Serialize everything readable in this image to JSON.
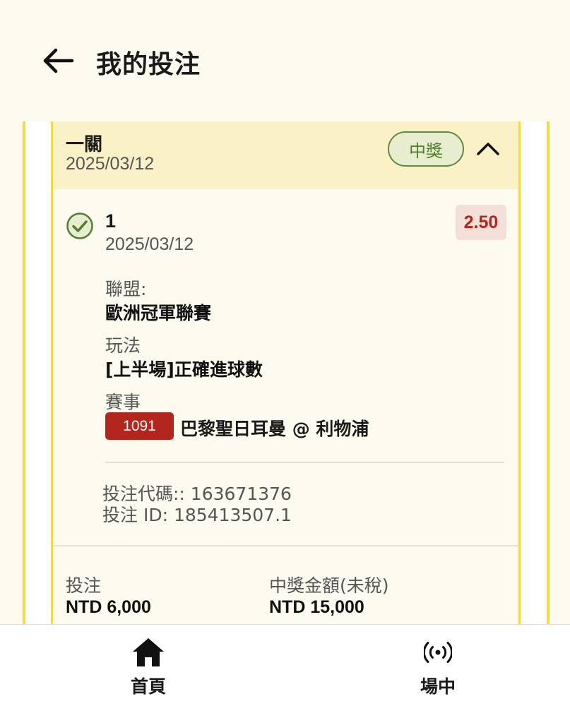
{
  "header": {
    "title": "我的投注",
    "back_icon": "arrow-left-icon"
  },
  "bet": {
    "type": "一關",
    "date": "2025/03/12",
    "status": "中獎",
    "status_color": "#4f7d2e",
    "accent_color": "#f4d94b",
    "collapse_icon": "chevron-up-icon",
    "selection": {
      "number": "1",
      "date": "2025/03/12",
      "odds": "2.50",
      "status_icon": "check-circle-icon",
      "league_label": "聯盟:",
      "league_value": "歐洲冠軍聯賽",
      "market_label": "玩法",
      "market_value": "[上半場]正確進球數",
      "event_label": "賽事",
      "event_id": "1091",
      "event_name": "巴黎聖日耳曼 @ 利物浦"
    },
    "bet_code": "投注代碼:: 163671376",
    "bet_id": "投注 ID: 185413507.1",
    "stake_label": "投注",
    "stake_value": "NTD 6,000",
    "payout_label": "中獎金額(未稅)",
    "payout_value": "NTD 15,000"
  },
  "nav": {
    "home_label": "首頁",
    "home_icon": "home-icon",
    "live_label": "場中",
    "live_icon": "live-broadcast-icon"
  }
}
